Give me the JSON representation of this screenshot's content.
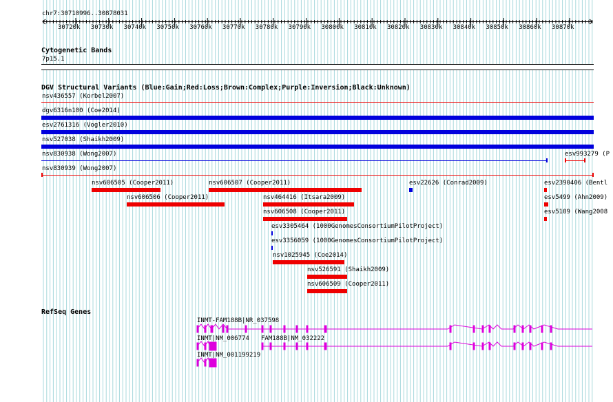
{
  "browser": {
    "position": "chr7:30710996..30878031",
    "ticks": [
      "30720k",
      "30730k",
      "30740k",
      "30750k",
      "30760k",
      "30770k",
      "30780k",
      "30790k",
      "30800k",
      "30810k",
      "30820k",
      "30830k",
      "30840k",
      "30850k",
      "30860k",
      "30870k"
    ]
  },
  "cytoband": {
    "title": "Cytogenetic Bands",
    "band": "7p15.1"
  },
  "dgv": {
    "title": "DGV Structural Variants (Blue:Gain;Red:Loss;Brown:Complex;Purple:Inversion;Black:Unknown)",
    "full_rows": [
      {
        "label": "nsv436557 (Korbel2007)",
        "type": "loss"
      },
      {
        "label": "dgv6316n100 (Coe2014)",
        "type": "gain"
      },
      {
        "label": "esv2761316 (Vogler2010)",
        "type": "gain"
      },
      {
        "label": "nsv527038 (Shaikh2009)",
        "type": "gain"
      }
    ],
    "nsv830938": "nsv830938 (Wong2007)",
    "esv993279": "esv993279 (P",
    "nsv830939": "nsv830939 (Wong2007)",
    "labels": {
      "nsv606505": "nsv606505 (Cooper2011)",
      "nsv606507": "nsv606507 (Cooper2011)",
      "esv22626": "esv22626 (Conrad2009)",
      "esv2390406": "esv2390406 (Bentl",
      "nsv606506": "nsv606506 (Cooper2011)",
      "nsv464416": "nsv464416 (Itsara2009)",
      "esv5499": "esv5499 (Ahn2009)",
      "nsv606508": "nsv606508 (Cooper2011)",
      "esv5109": "esv5109 (Wang2008",
      "esv3305464": "esv3305464 (1000GenomesConsortiumPilotProject)",
      "esv3356059": "esv3356059 (1000GenomesConsortiumPilotProject)",
      "nsv1025945": "nsv1025945 (Coe2014)",
      "nsv526591": "nsv526591 (Shaikh2009)",
      "nsv606509": "nsv606509 (Cooper2011)"
    }
  },
  "refseq": {
    "title": "RefSeq Genes",
    "genes": {
      "inmt_fam188b": "INMT-FAM188B|NR_037598",
      "inmt_006774": "INMT|NM_006774",
      "fam188b": "FAM188B|NM_032222",
      "inmt_001199219": "INMT|NM_001199219"
    }
  },
  "colors": {
    "gain": "#0000dd",
    "loss": "#ee0000",
    "gene": "#dd00dd",
    "grid": "#a8d8dc"
  }
}
